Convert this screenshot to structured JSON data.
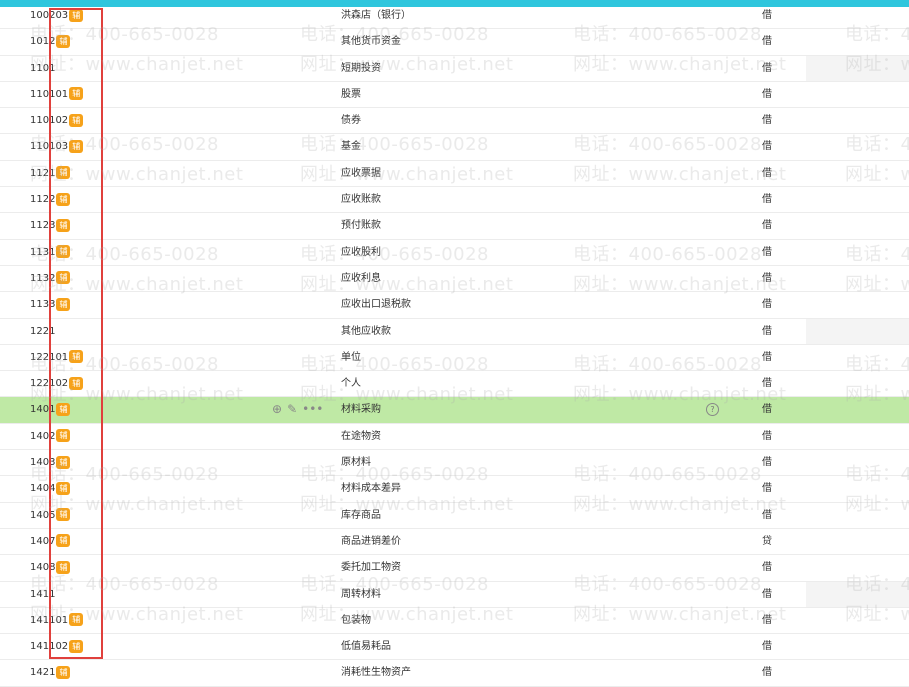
{
  "watermark": {
    "phone": "电话：400-665-0028",
    "site": "网址：www.chanjet.net"
  },
  "colors": {
    "accent": "#2fc6dd",
    "badge": "#f6a21a",
    "highlight": "#bfe9a5",
    "annotation": "#e0403c"
  },
  "badge_label": "辅",
  "rows": [
    {
      "code": "100203",
      "badge": true,
      "name": "洪森店（银行）",
      "dir": "借"
    },
    {
      "code": "1012",
      "badge": true,
      "name": "其他货币资金",
      "dir": "借"
    },
    {
      "code": "1101",
      "badge": false,
      "name": "短期投资",
      "dir": "借"
    },
    {
      "code": "110101",
      "badge": true,
      "name": "股票",
      "dir": "借"
    },
    {
      "code": "110102",
      "badge": true,
      "name": "债券",
      "dir": "借"
    },
    {
      "code": "110103",
      "badge": true,
      "name": "基金",
      "dir": "借"
    },
    {
      "code": "1121",
      "badge": true,
      "name": "应收票据",
      "dir": "借"
    },
    {
      "code": "1122",
      "badge": true,
      "name": "应收账款",
      "dir": "借"
    },
    {
      "code": "1123",
      "badge": true,
      "name": "预付账款",
      "dir": "借"
    },
    {
      "code": "1131",
      "badge": true,
      "name": "应收股利",
      "dir": "借"
    },
    {
      "code": "1132",
      "badge": true,
      "name": "应收利息",
      "dir": "借"
    },
    {
      "code": "1133",
      "badge": true,
      "name": "应收出口退税款",
      "dir": "借"
    },
    {
      "code": "1221",
      "badge": false,
      "name": "其他应收款",
      "dir": "借"
    },
    {
      "code": "122101",
      "badge": true,
      "name": "单位",
      "dir": "借"
    },
    {
      "code": "122102",
      "badge": true,
      "name": "个人",
      "dir": "借"
    },
    {
      "code": "1401",
      "badge": true,
      "name": "材料采购",
      "dir": "借",
      "highlight": true
    },
    {
      "code": "1402",
      "badge": true,
      "name": "在途物资",
      "dir": "借"
    },
    {
      "code": "1403",
      "badge": true,
      "name": "原材料",
      "dir": "借"
    },
    {
      "code": "1404",
      "badge": true,
      "name": "材料成本差异",
      "dir": "借"
    },
    {
      "code": "1405",
      "badge": true,
      "name": "库存商品",
      "dir": "借"
    },
    {
      "code": "1407",
      "badge": true,
      "name": "商品进销差价",
      "dir": "贷"
    },
    {
      "code": "1408",
      "badge": true,
      "name": "委托加工物资",
      "dir": "借"
    },
    {
      "code": "1411",
      "badge": false,
      "name": "周转材料",
      "dir": "借"
    },
    {
      "code": "141101",
      "badge": true,
      "name": "包装物",
      "dir": "借"
    },
    {
      "code": "141102",
      "badge": true,
      "name": "低值易耗品",
      "dir": "借"
    },
    {
      "code": "1421",
      "badge": true,
      "name": "消耗性生物资产",
      "dir": "借"
    }
  ],
  "ops": {
    "add_icon": "⊕",
    "edit_icon": "✎",
    "more_icon": "•••",
    "help_icon": "?"
  }
}
